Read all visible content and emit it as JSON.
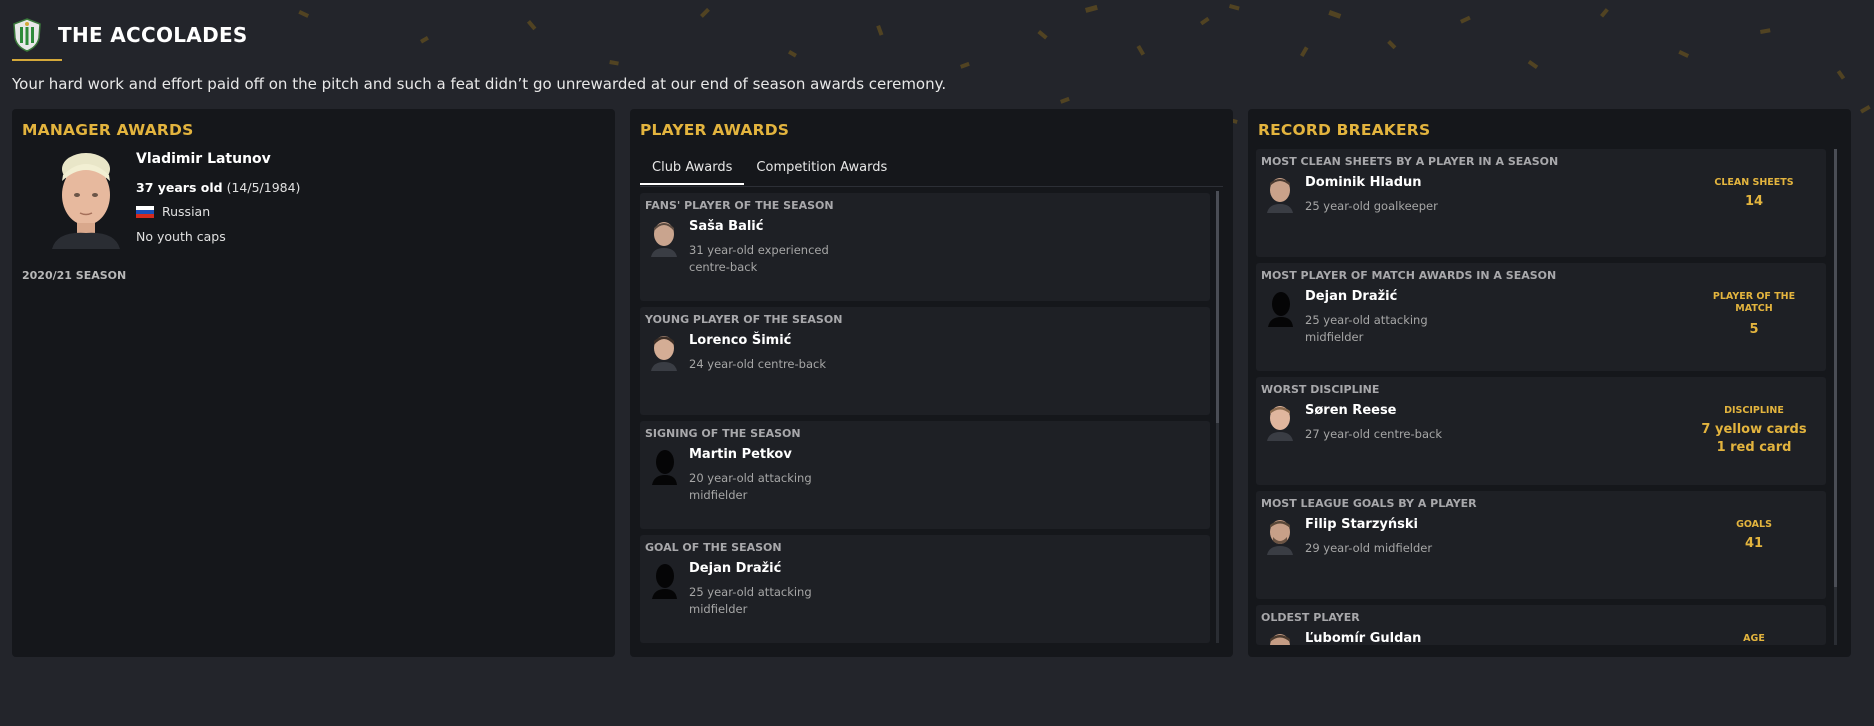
{
  "header": {
    "title": "THE ACCOLADES",
    "crest_icon": "club-crest-icon",
    "intro": "Your hard work and effort paid off on the pitch and such a feat didn’t go unrewarded at our end of season awards ceremony."
  },
  "colors": {
    "accent": "#e3b43e",
    "background": "#23252b",
    "panel": "#15171b",
    "card": "#1e2025"
  },
  "manager": {
    "title": "MANAGER AWARDS",
    "name": "Vladimir Latunov",
    "age": "37 years old",
    "dob": "(14/5/1984)",
    "nationality": "Russian",
    "caps": "No youth caps",
    "season": "2020/21 SEASON"
  },
  "player_awards": {
    "title": "PLAYER AWARDS",
    "tabs": [
      {
        "label": "Club Awards",
        "active": true
      },
      {
        "label": "Competition Awards",
        "active": false
      }
    ],
    "items": [
      {
        "award": "FANS' PLAYER OF THE SEASON",
        "name": "Saša Balić",
        "desc_1": "31 year-old experienced",
        "desc_2": "centre-back"
      },
      {
        "award": "YOUNG PLAYER OF THE SEASON",
        "name": "Lorenco Šimić",
        "desc_1": "24 year-old centre-back",
        "desc_2": ""
      },
      {
        "award": "SIGNING OF THE SEASON",
        "name": "Martin Petkov",
        "desc_1": "20 year-old attacking",
        "desc_2": "midfielder"
      },
      {
        "award": "GOAL OF THE SEASON",
        "name": "Dejan Dražić",
        "desc_1": "25 year-old attacking",
        "desc_2": "midfielder"
      }
    ]
  },
  "record_breakers": {
    "title": "RECORD BREAKERS",
    "items": [
      {
        "record": "MOST CLEAN SHEETS BY A PLAYER IN A SEASON",
        "name": "Dominik Hladun",
        "desc_1": "25 year-old goalkeeper",
        "desc_2": "",
        "stat_label": "CLEAN SHEETS",
        "stat_1": "14",
        "stat_2": ""
      },
      {
        "record": "MOST PLAYER OF MATCH AWARDS IN A SEASON",
        "name": "Dejan Dražić",
        "desc_1": "25 year-old attacking",
        "desc_2": "midfielder",
        "stat_label": "PLAYER OF THE MATCH",
        "stat_1": "5",
        "stat_2": ""
      },
      {
        "record": "WORST DISCIPLINE",
        "name": "Søren Reese",
        "desc_1": "27 year-old centre-back",
        "desc_2": "",
        "stat_label": "DISCIPLINE",
        "stat_1": "7 yellow cards",
        "stat_2": "1 red card"
      },
      {
        "record": "MOST LEAGUE GOALS BY A PLAYER",
        "name": "Filip Starzyński",
        "desc_1": "29 year-old midfielder",
        "desc_2": "",
        "stat_label": "GOALS",
        "stat_1": "41",
        "stat_2": ""
      },
      {
        "record": "OLDEST PLAYER",
        "name": "Ľubomír Guldan",
        "desc_1": "",
        "desc_2": "",
        "stat_label": "AGE",
        "stat_1": "",
        "stat_2": ""
      }
    ]
  }
}
